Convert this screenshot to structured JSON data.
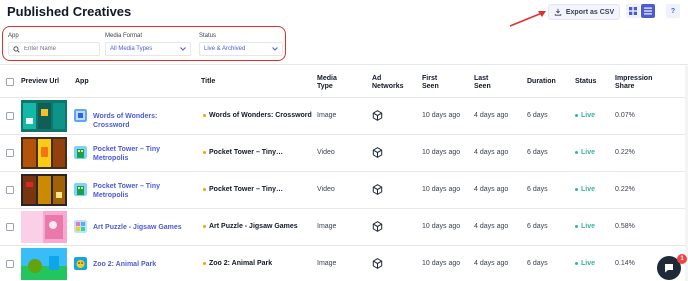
{
  "page_title": "Published Creatives",
  "toolbar": {
    "export_label": "Export as CSV",
    "help_label": "?"
  },
  "filters": {
    "app": {
      "label": "App",
      "placeholder": "Enter Name"
    },
    "media_format": {
      "label": "Media Format",
      "value": "All Media Types"
    },
    "status": {
      "label": "Status",
      "value": "Live & Archived"
    }
  },
  "columns": {
    "preview": "Preview Url",
    "app": "App",
    "title": "Title",
    "media_type": "Media Type",
    "ad_networks": "Ad Networks",
    "first_seen": "First Seen",
    "last_seen": "Last Seen",
    "duration": "Duration",
    "status": "Status",
    "impression_share": "Impression Share"
  },
  "rows": [
    {
      "app": "Words of Wonders: Crossword",
      "title": "Words of Wonders: Crossword",
      "media_type": "Image",
      "first_seen": "10 days ago",
      "last_seen": "4 days ago",
      "duration": "6 days",
      "status": "Live",
      "impression_share": "0.07%"
    },
    {
      "app": "Pocket Tower – Tiny Metropolis",
      "title": "Pocket Tower – Tiny…",
      "media_type": "Video",
      "first_seen": "10 days ago",
      "last_seen": "4 days ago",
      "duration": "6 days",
      "status": "Live",
      "impression_share": "0.22%"
    },
    {
      "app": "Pocket Tower – Tiny Metropolis",
      "title": "Pocket Tower – Tiny…",
      "media_type": "Video",
      "first_seen": "10 days ago",
      "last_seen": "4 days ago",
      "duration": "6 days",
      "status": "Live",
      "impression_share": "0.22%"
    },
    {
      "app": "Art Puzzle - Jigsaw Games",
      "title": "Art Puzzle - Jigsaw Games",
      "media_type": "Image",
      "first_seen": "10 days ago",
      "last_seen": "4 days ago",
      "duration": "6 days",
      "status": "Live",
      "impression_share": "0.58%"
    },
    {
      "app": "Zoo 2: Animal Park",
      "title": "Zoo 2: Animal Park",
      "media_type": "Image",
      "first_seen": "10 days ago",
      "last_seen": "4 days ago",
      "duration": "6 days",
      "status": "Live",
      "impression_share": "0.14%"
    }
  ],
  "chat": {
    "badge_count": "1"
  },
  "colors": {
    "accent": "#4a5bd4",
    "live": "#3ab0a6",
    "highlight_border": "#e0302c",
    "title_dot": "#f59e0b"
  }
}
